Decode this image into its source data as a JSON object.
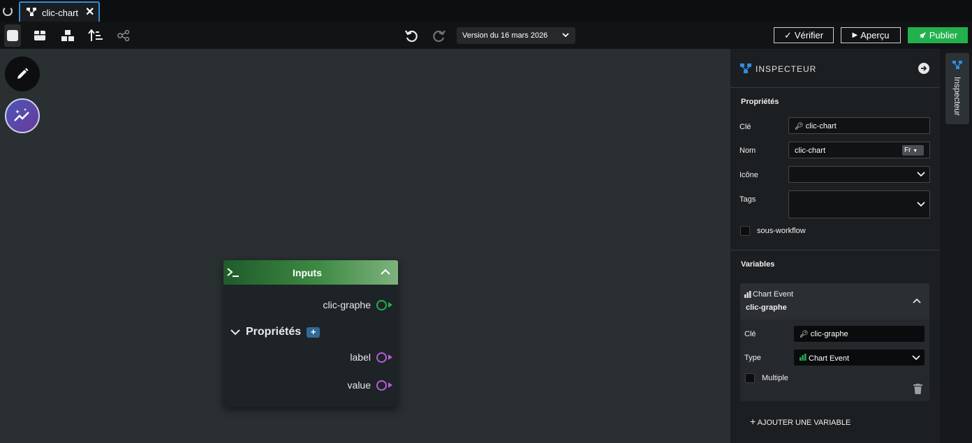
{
  "tab": {
    "label": "clic-chart",
    "close": "✕"
  },
  "toolbar": {
    "version": "Version du 16 mars 2026",
    "verifier": "Vérifier",
    "apercu": "Aperçu",
    "publier": "Publier"
  },
  "node": {
    "title": "Inputs",
    "event_port": "clic-graphe",
    "props_label": "Propriétés",
    "add": "+",
    "ports": [
      {
        "label": "label"
      },
      {
        "label": "value"
      }
    ]
  },
  "inspector": {
    "title": "INSPECTEUR",
    "properties_title": "Propriétés",
    "cle_label": "Clé",
    "cle_value": "clic-chart",
    "nom_label": "Nom",
    "nom_value": "clic-chart",
    "lang": "Fr",
    "icone_label": "Icône",
    "tags_label": "Tags",
    "subworkflow_label": "sous-workflow",
    "variables_title": "Variables",
    "variable": {
      "type_label": "Chart Event",
      "name": "clic-graphe",
      "cle_label": "Clé",
      "cle_value": "clic-graphe",
      "type_field_label": "Type",
      "type_value": "Chart Event",
      "multiple_label": "Multiple"
    },
    "add_variable": "AJOUTER UNE VARIABLE"
  },
  "rail": {
    "label": "Inspecteur"
  },
  "colors": {
    "accent": "#2f8fe0",
    "publish": "#22b14c",
    "event_port": "#22b14c",
    "prop_port": "#b85ed8"
  }
}
